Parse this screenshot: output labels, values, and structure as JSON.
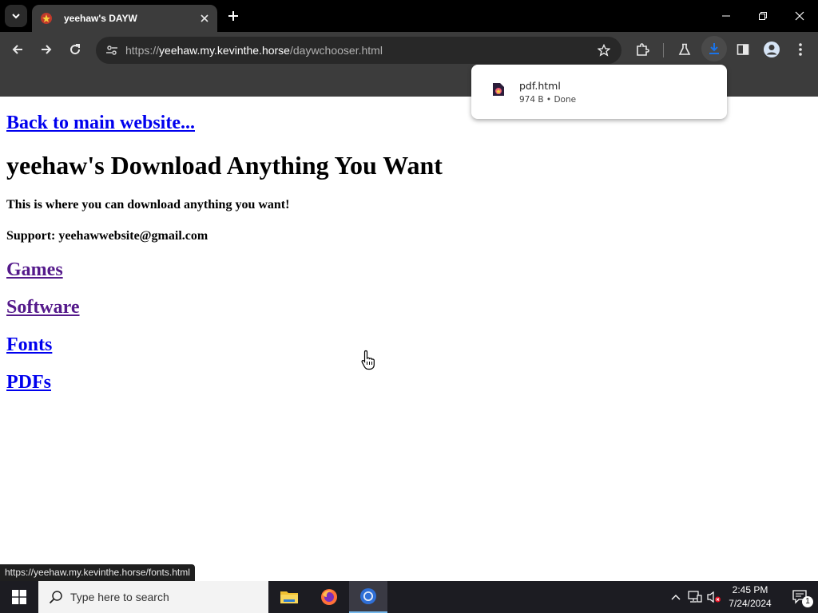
{
  "browser": {
    "tab_title": "yeehaw's DAYW",
    "url_scheme": "https://",
    "url_host": "yeehaw.my.kevinthe.horse",
    "url_path": "/daywchooser.html"
  },
  "download": {
    "filename": "pdf.html",
    "meta": "974 B • Done"
  },
  "page": {
    "back_link": "Back to main website...",
    "title": "yeehaw's Download Anything You Want",
    "description": "This is where you can download anything you want!",
    "support": "Support: yeehawwebsite@gmail.com",
    "categories": [
      {
        "label": "Games",
        "visited": true
      },
      {
        "label": "Software",
        "visited": true
      },
      {
        "label": "Fonts",
        "visited": false
      },
      {
        "label": "PDFs",
        "visited": false
      }
    ]
  },
  "status_url": "https://yeehaw.my.kevinthe.horse/fonts.html",
  "taskbar": {
    "search_placeholder": "Type here to search",
    "time": "2:45 PM",
    "date": "7/24/2024",
    "notification_count": "1"
  },
  "icons": {
    "tab_search": "chevron-down-icon",
    "back": "arrow-left-icon",
    "forward": "arrow-right-icon",
    "reload": "reload-icon",
    "bookmark": "star-icon",
    "extensions": "puzzle-icon",
    "labs": "flask-icon",
    "downloads": "download-icon",
    "side_panel": "side-panel-icon",
    "profile": "profile-icon",
    "menu": "kebab-menu-icon"
  },
  "colors": {
    "link": "#0000ee",
    "visited_link": "#551a8b",
    "chrome_dark": "#3c3c3c",
    "taskbar": "#1c1c22"
  }
}
